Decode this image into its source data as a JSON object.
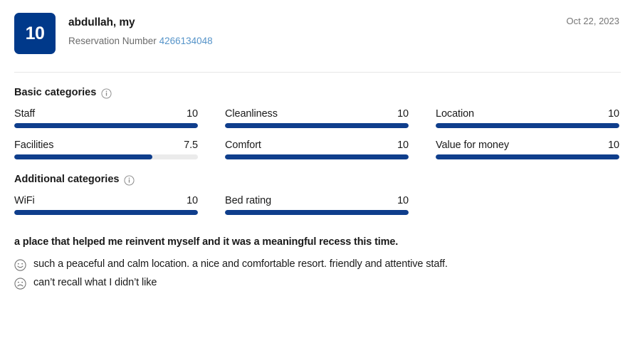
{
  "header": {
    "score": "10",
    "reviewer_name": "abdullah, my",
    "reservation_label": "Reservation Number",
    "reservation_number": "4266134048",
    "date": "Oct 22, 2023",
    "score_badge_color": "#00398a",
    "link_color": "#5694c9"
  },
  "basic_categories": {
    "heading": "Basic categories",
    "info_icon": "info-circle-icon",
    "items": [
      {
        "label": "Staff",
        "value": "10",
        "percent": 100
      },
      {
        "label": "Cleanliness",
        "value": "10",
        "percent": 100
      },
      {
        "label": "Location",
        "value": "10",
        "percent": 100
      },
      {
        "label": "Facilities",
        "value": "7.5",
        "percent": 75
      },
      {
        "label": "Comfort",
        "value": "10",
        "percent": 100
      },
      {
        "label": "Value for money",
        "value": "10",
        "percent": 100
      }
    ]
  },
  "additional_categories": {
    "heading": "Additional categories",
    "info_icon": "info-circle-icon",
    "items": [
      {
        "label": "WiFi",
        "value": "10",
        "percent": 100
      },
      {
        "label": "Bed rating",
        "value": "10",
        "percent": 100
      }
    ]
  },
  "review": {
    "title": "a place that helped me reinvent myself and it was a meaningful recess this time.",
    "positive": {
      "icon": "smiley-face-icon",
      "text": "such a peaceful and calm location. a nice and comfortable resort. friendly and attentive staff."
    },
    "negative": {
      "icon": "frowny-face-icon",
      "text": "can’t recall what I didn’t like"
    }
  },
  "colors": {
    "bar_fill": "#0f3e8c",
    "bar_track": "#ebebeb",
    "divider": "#e7e7e7"
  }
}
